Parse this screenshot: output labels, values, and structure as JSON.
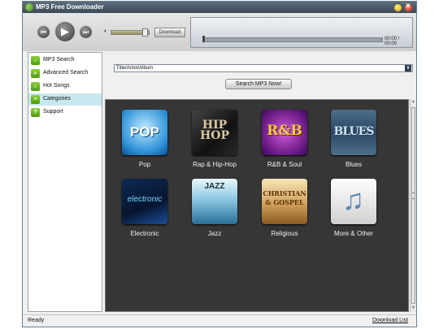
{
  "window": {
    "title": "MP3 Free Downloader"
  },
  "player": {
    "prev_icon": "skip-back-icon",
    "play_icon": "play-icon",
    "next_icon": "skip-forward-icon",
    "download_label": "Download",
    "time": "00:00 / 00:00",
    "volume_fraction": 0.9,
    "progress_fraction": 0.0
  },
  "sidebar": {
    "items": [
      {
        "label": "MP3 Search",
        "icon": "music-note-icon",
        "glyph": "♪",
        "active": false
      },
      {
        "label": "Advanced Search",
        "icon": "search-icon",
        "glyph": "🔍",
        "active": false
      },
      {
        "label": "Hot Songs",
        "icon": "headphones-icon",
        "glyph": "∩",
        "active": false
      },
      {
        "label": "Categories",
        "icon": "categories-icon",
        "glyph": "≡",
        "active": true
      },
      {
        "label": "Support",
        "icon": "help-icon",
        "glyph": "?",
        "active": false
      }
    ]
  },
  "search": {
    "field_value": "Title/Artist/Album",
    "button_label": "Search MP3 Now!"
  },
  "categories": [
    {
      "label": "Pop",
      "art": "POP"
    },
    {
      "label": "Rap & Hip-Hop",
      "art": "HIP HOP"
    },
    {
      "label": "R&B & Soul",
      "art": "R&B"
    },
    {
      "label": "Blues",
      "art": "BLUES"
    },
    {
      "label": "Electronic",
      "art": "electronic"
    },
    {
      "label": "Jazz",
      "art": "JAZZ"
    },
    {
      "label": "Religious",
      "art": "CHRISTIAN & GOSPEL"
    },
    {
      "label": "More & Other",
      "art": ""
    }
  ],
  "statusbar": {
    "status": "Ready",
    "download_list": "Download List"
  },
  "colors": {
    "panel_bg": "#363636",
    "sidebar_active": "#c8e8f0",
    "icon_green": "#6cb323"
  }
}
